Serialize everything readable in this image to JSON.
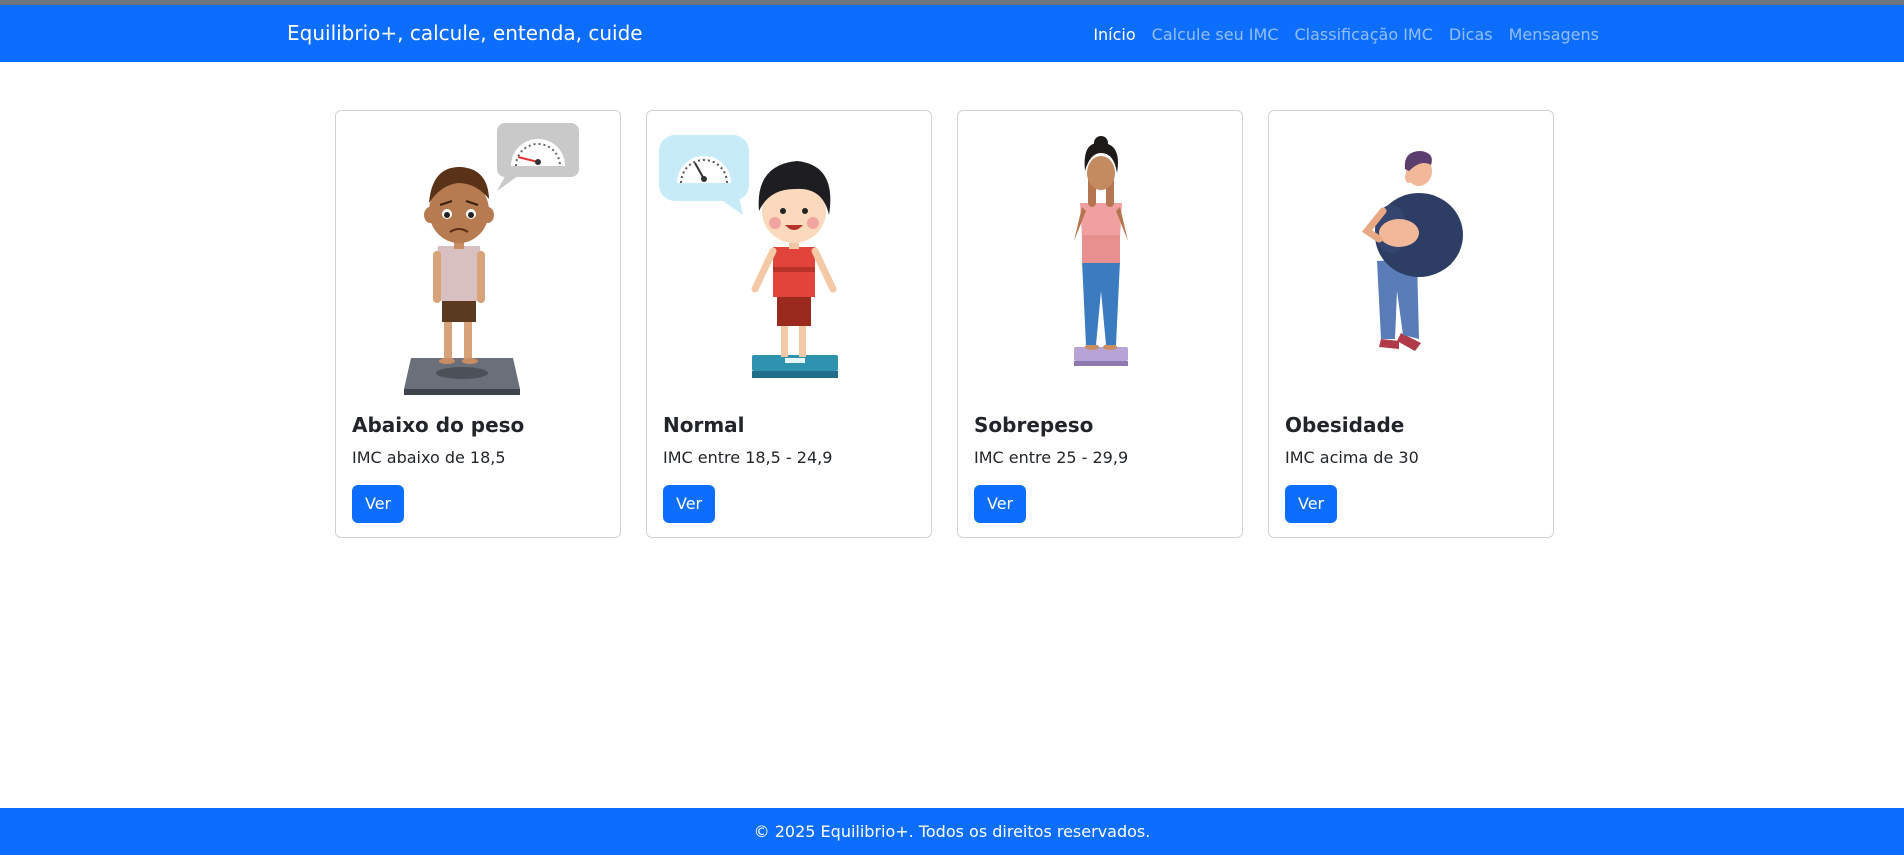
{
  "navbar": {
    "brand": "Equilibrio+, calcule, entenda, cuide",
    "links": [
      {
        "label": "Início",
        "active": true
      },
      {
        "label": "Calcule seu IMC",
        "active": false
      },
      {
        "label": "Classificação IMC",
        "active": false
      },
      {
        "label": "Dicas",
        "active": false
      },
      {
        "label": "Mensagens",
        "active": false
      }
    ]
  },
  "cards": [
    {
      "title": "Abaixo do peso",
      "text": "IMC abaixo de 18,5",
      "button": "Ver",
      "image_icon": "underweight-boy-on-scale"
    },
    {
      "title": "Normal",
      "text": "IMC entre 18,5 - 24,9",
      "button": "Ver",
      "image_icon": "normal-boy-on-scale"
    },
    {
      "title": "Sobrepeso",
      "text": "IMC entre 25 - 29,9",
      "button": "Ver",
      "image_icon": "overweight-woman-on-scale"
    },
    {
      "title": "Obesidade",
      "text": "IMC acima de 30",
      "button": "Ver",
      "image_icon": "obese-man-walking"
    }
  ],
  "footer": {
    "text": "© 2025 Equilibrio+. Todos os direitos reservados."
  },
  "colors": {
    "primary": "#0d6efd",
    "text": "#212529"
  }
}
